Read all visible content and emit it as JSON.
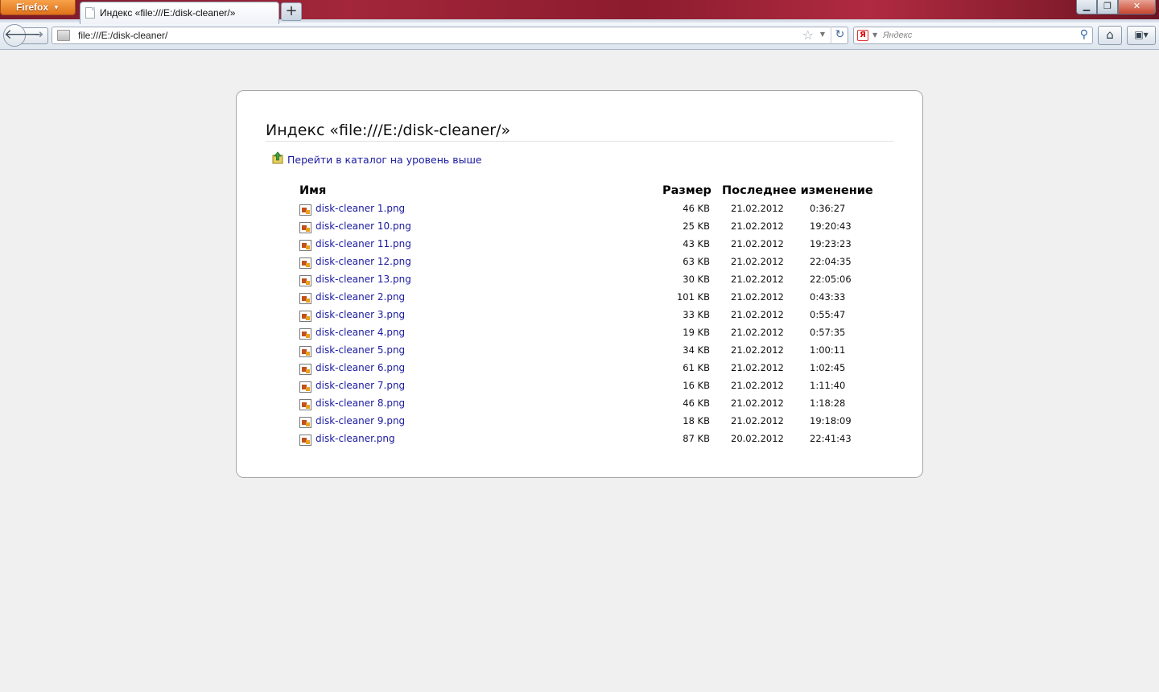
{
  "browser": {
    "app_button": "Firefox",
    "tab_title": "Индекс «file:///E:/disk-cleaner/»",
    "new_tab": "+",
    "url": "file:///E:/disk-cleaner/",
    "search_placeholder": "Яндекс",
    "search_engine_letter": "Я"
  },
  "page": {
    "heading": "Индекс «file:///E:/disk-cleaner/»",
    "parent_link": "Перейти в каталог на уровень выше",
    "columns": {
      "name": "Имя",
      "size": "Размер",
      "modified": "Последнее изменение"
    },
    "files": [
      {
        "name": "disk-cleaner 1.png",
        "size": "46 KB",
        "date": "21.02.2012",
        "time": "0:36:27"
      },
      {
        "name": "disk-cleaner 10.png",
        "size": "25 KB",
        "date": "21.02.2012",
        "time": "19:20:43"
      },
      {
        "name": "disk-cleaner 11.png",
        "size": "43 KB",
        "date": "21.02.2012",
        "time": "19:23:23"
      },
      {
        "name": "disk-cleaner 12.png",
        "size": "63 KB",
        "date": "21.02.2012",
        "time": "22:04:35"
      },
      {
        "name": "disk-cleaner 13.png",
        "size": "30 KB",
        "date": "21.02.2012",
        "time": "22:05:06"
      },
      {
        "name": "disk-cleaner 2.png",
        "size": "101 KB",
        "date": "21.02.2012",
        "time": "0:43:33"
      },
      {
        "name": "disk-cleaner 3.png",
        "size": "33 KB",
        "date": "21.02.2012",
        "time": "0:55:47"
      },
      {
        "name": "disk-cleaner 4.png",
        "size": "19 KB",
        "date": "21.02.2012",
        "time": "0:57:35"
      },
      {
        "name": "disk-cleaner 5.png",
        "size": "34 KB",
        "date": "21.02.2012",
        "time": "1:00:11"
      },
      {
        "name": "disk-cleaner 6.png",
        "size": "61 KB",
        "date": "21.02.2012",
        "time": "1:02:45"
      },
      {
        "name": "disk-cleaner 7.png",
        "size": "16 KB",
        "date": "21.02.2012",
        "time": "1:11:40"
      },
      {
        "name": "disk-cleaner 8.png",
        "size": "46 KB",
        "date": "21.02.2012",
        "time": "1:18:28"
      },
      {
        "name": "disk-cleaner 9.png",
        "size": "18 KB",
        "date": "21.02.2012",
        "time": "19:18:09"
      },
      {
        "name": "disk-cleaner.png",
        "size": "87 KB",
        "date": "20.02.2012",
        "time": "22:41:43"
      }
    ]
  },
  "colors": {
    "link": "#1a1aa0",
    "page_background": "#f0f0f0",
    "firefox_button": "#e0721a"
  }
}
